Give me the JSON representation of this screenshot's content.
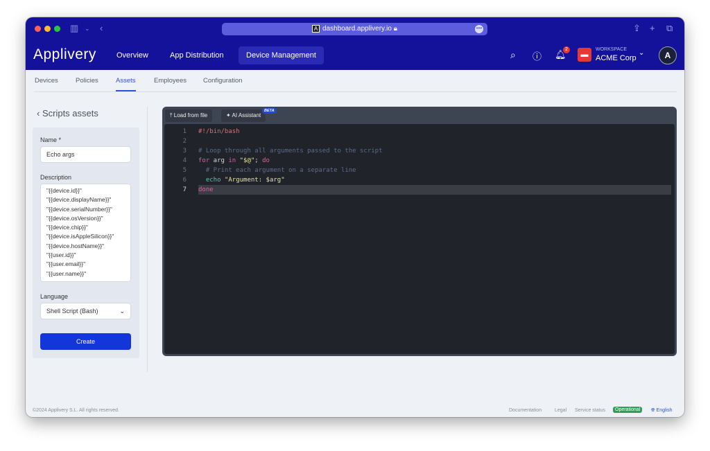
{
  "browser": {
    "url": "dashboard.applivery.io"
  },
  "nav": {
    "logo": "Applivery",
    "items": [
      {
        "label": "Overview"
      },
      {
        "label": "App Distribution"
      },
      {
        "label": "Device Management"
      }
    ],
    "notifications": "2",
    "workspace_label": "WORKSPACE",
    "workspace_name": "ACME Corp"
  },
  "subtabs": [
    {
      "label": "Devices"
    },
    {
      "label": "Policies"
    },
    {
      "label": "Assets"
    },
    {
      "label": "Employees"
    },
    {
      "label": "Configuration"
    }
  ],
  "back_label": "Scripts assets",
  "form": {
    "name_label": "Name *",
    "name_value": "Echo args",
    "description_label": "Description",
    "description_lines": [
      "\"{{device.id}}\"",
      "\"{{device.displayName}}\"",
      "\"{{device.serialNumber}}\"",
      "\"{{device.osVersion}}\"",
      "\"{{device.chip}}\"",
      "\"{{device.isAppleSilicon}}\"",
      "\"{{device.hostName}}\"",
      "\"{{user.id}}\"",
      "\"{{user.email}}\"",
      "\"{{user.name}}\""
    ],
    "language_label": "Language",
    "language_value": "Shell Script (Bash)",
    "create_label": "Create"
  },
  "editor": {
    "load_label": "Load from file",
    "ai_label": "AI Assistant",
    "beta": "BETA",
    "lines": [
      [
        {
          "t": "#!/bin/bash",
          "c": "#e06c75"
        }
      ],
      [],
      [
        {
          "t": "# Loop through all arguments passed to the script",
          "c": "#5c6c8a"
        }
      ],
      [
        {
          "t": "for",
          "c": "#e05fa0"
        },
        {
          "t": " arg ",
          "c": "#d4d4d4"
        },
        {
          "t": "in",
          "c": "#e05fa0"
        },
        {
          "t": " \"$@\"",
          "c": "#e5e59a"
        },
        {
          "t": "; ",
          "c": "#d4d4d4"
        },
        {
          "t": "do",
          "c": "#e05fa0"
        }
      ],
      [
        {
          "t": "  # Print each argument on a separate line",
          "c": "#5c6c8a"
        }
      ],
      [
        {
          "t": "  echo",
          "c": "#4ec9b0"
        },
        {
          "t": " \"Argument: $arg\"",
          "c": "#e5e59a"
        }
      ],
      [
        {
          "t": "done",
          "c": "#e05fa0"
        }
      ]
    ],
    "current_line": 7
  },
  "footer": {
    "copyright": "©2024 Applivery S.L. All rights reserved.",
    "documentation": "Documentation",
    "legal": "Legal",
    "service_status": "Service status",
    "status": "Operational",
    "language": "English"
  }
}
